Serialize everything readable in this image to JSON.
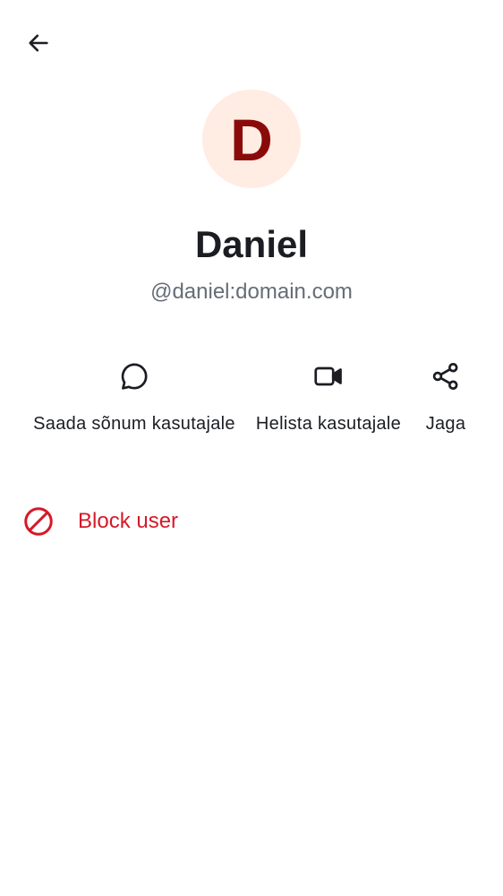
{
  "header": {
    "back_icon": "arrow-left-icon"
  },
  "profile": {
    "avatar_letter": "D",
    "avatar_bg": "#ffece3",
    "avatar_fg": "#8a0a0a",
    "display_name": "Daniel",
    "user_id": "@daniel:domain.com"
  },
  "actions": [
    {
      "label": "Saada sõnum kasutajale",
      "icon": "chat-bubble-icon"
    },
    {
      "label": "Helista kasutajale",
      "icon": "video-call-icon"
    },
    {
      "label": "Jaga",
      "icon": "share-icon"
    }
  ],
  "block": {
    "label": "Block user",
    "icon": "block-icon",
    "color": "#d51928"
  }
}
